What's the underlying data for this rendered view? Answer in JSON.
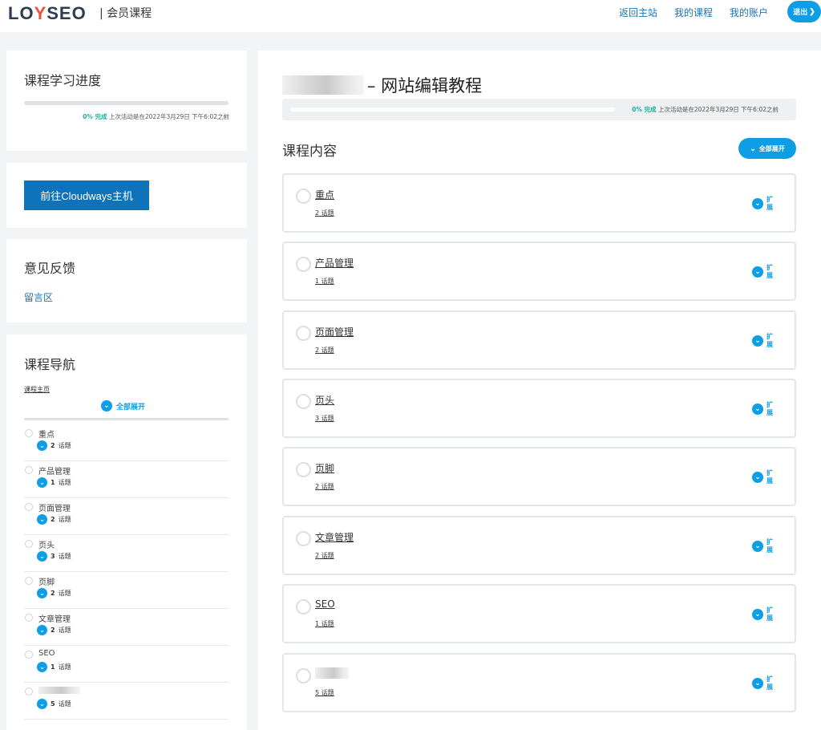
{
  "header": {
    "logo_left": "LO",
    "logo_accent": "Y",
    "logo_right": "SEO",
    "subtitle": "| 会员课程",
    "nav": [
      "返回主站",
      "我的课程",
      "我的账户"
    ],
    "logout_label": "退出",
    "logout_icon": "chevron-right-icon"
  },
  "sidebar": {
    "progress": {
      "title": "课程学习进度",
      "percent_label": "0% 完成",
      "percent_value": 0,
      "last_activity": "上次活动是在2022年3月29日 下午6:02之前"
    },
    "cta_label": "前往Cloudways主机",
    "feedback": {
      "title": "意见反馈",
      "link": "留言区"
    },
    "course_nav": {
      "title": "课程导航",
      "home_link": "课程主页",
      "expand_all": "全部展开",
      "items": [
        {
          "name": "重点",
          "count": "2",
          "topics_label": "话题"
        },
        {
          "name": "产品管理",
          "count": "1",
          "topics_label": "话题"
        },
        {
          "name": "页面管理",
          "count": "2",
          "topics_label": "话题"
        },
        {
          "name": "页头",
          "count": "3",
          "topics_label": "话题"
        },
        {
          "name": "页脚",
          "count": "2",
          "topics_label": "话题"
        },
        {
          "name": "文章管理",
          "count": "2",
          "topics_label": "话题"
        },
        {
          "name": "SEO",
          "count": "1",
          "topics_label": "话题"
        },
        {
          "name": "",
          "count": "5",
          "topics_label": "话题"
        }
      ]
    }
  },
  "main": {
    "title_suffix": "– 网站编辑教程",
    "progress": {
      "percent_label": "0% 完成",
      "percent_value": 0,
      "last_activity": "上次活动是在2022年3月29日 下午6:02之前"
    },
    "section_title": "课程内容",
    "expand_all": "全部展开",
    "expand_label": "扩展",
    "lessons": [
      {
        "name": "重点",
        "topics": "2 话题"
      },
      {
        "name": "产品管理",
        "topics": "1 话题"
      },
      {
        "name": "页面管理",
        "topics": "2 话题"
      },
      {
        "name": "页头",
        "topics": "3 话题"
      },
      {
        "name": "页脚",
        "topics": "2 话题"
      },
      {
        "name": "文章管理",
        "topics": "2 话题"
      },
      {
        "name": "SEO",
        "topics": "1 话题"
      },
      {
        "name": "",
        "topics": "5 话题"
      }
    ]
  },
  "colors": {
    "accent": "#0d9ee6",
    "cta": "#0f73bb",
    "link": "#1a73b5",
    "success": "#1bb29a"
  }
}
